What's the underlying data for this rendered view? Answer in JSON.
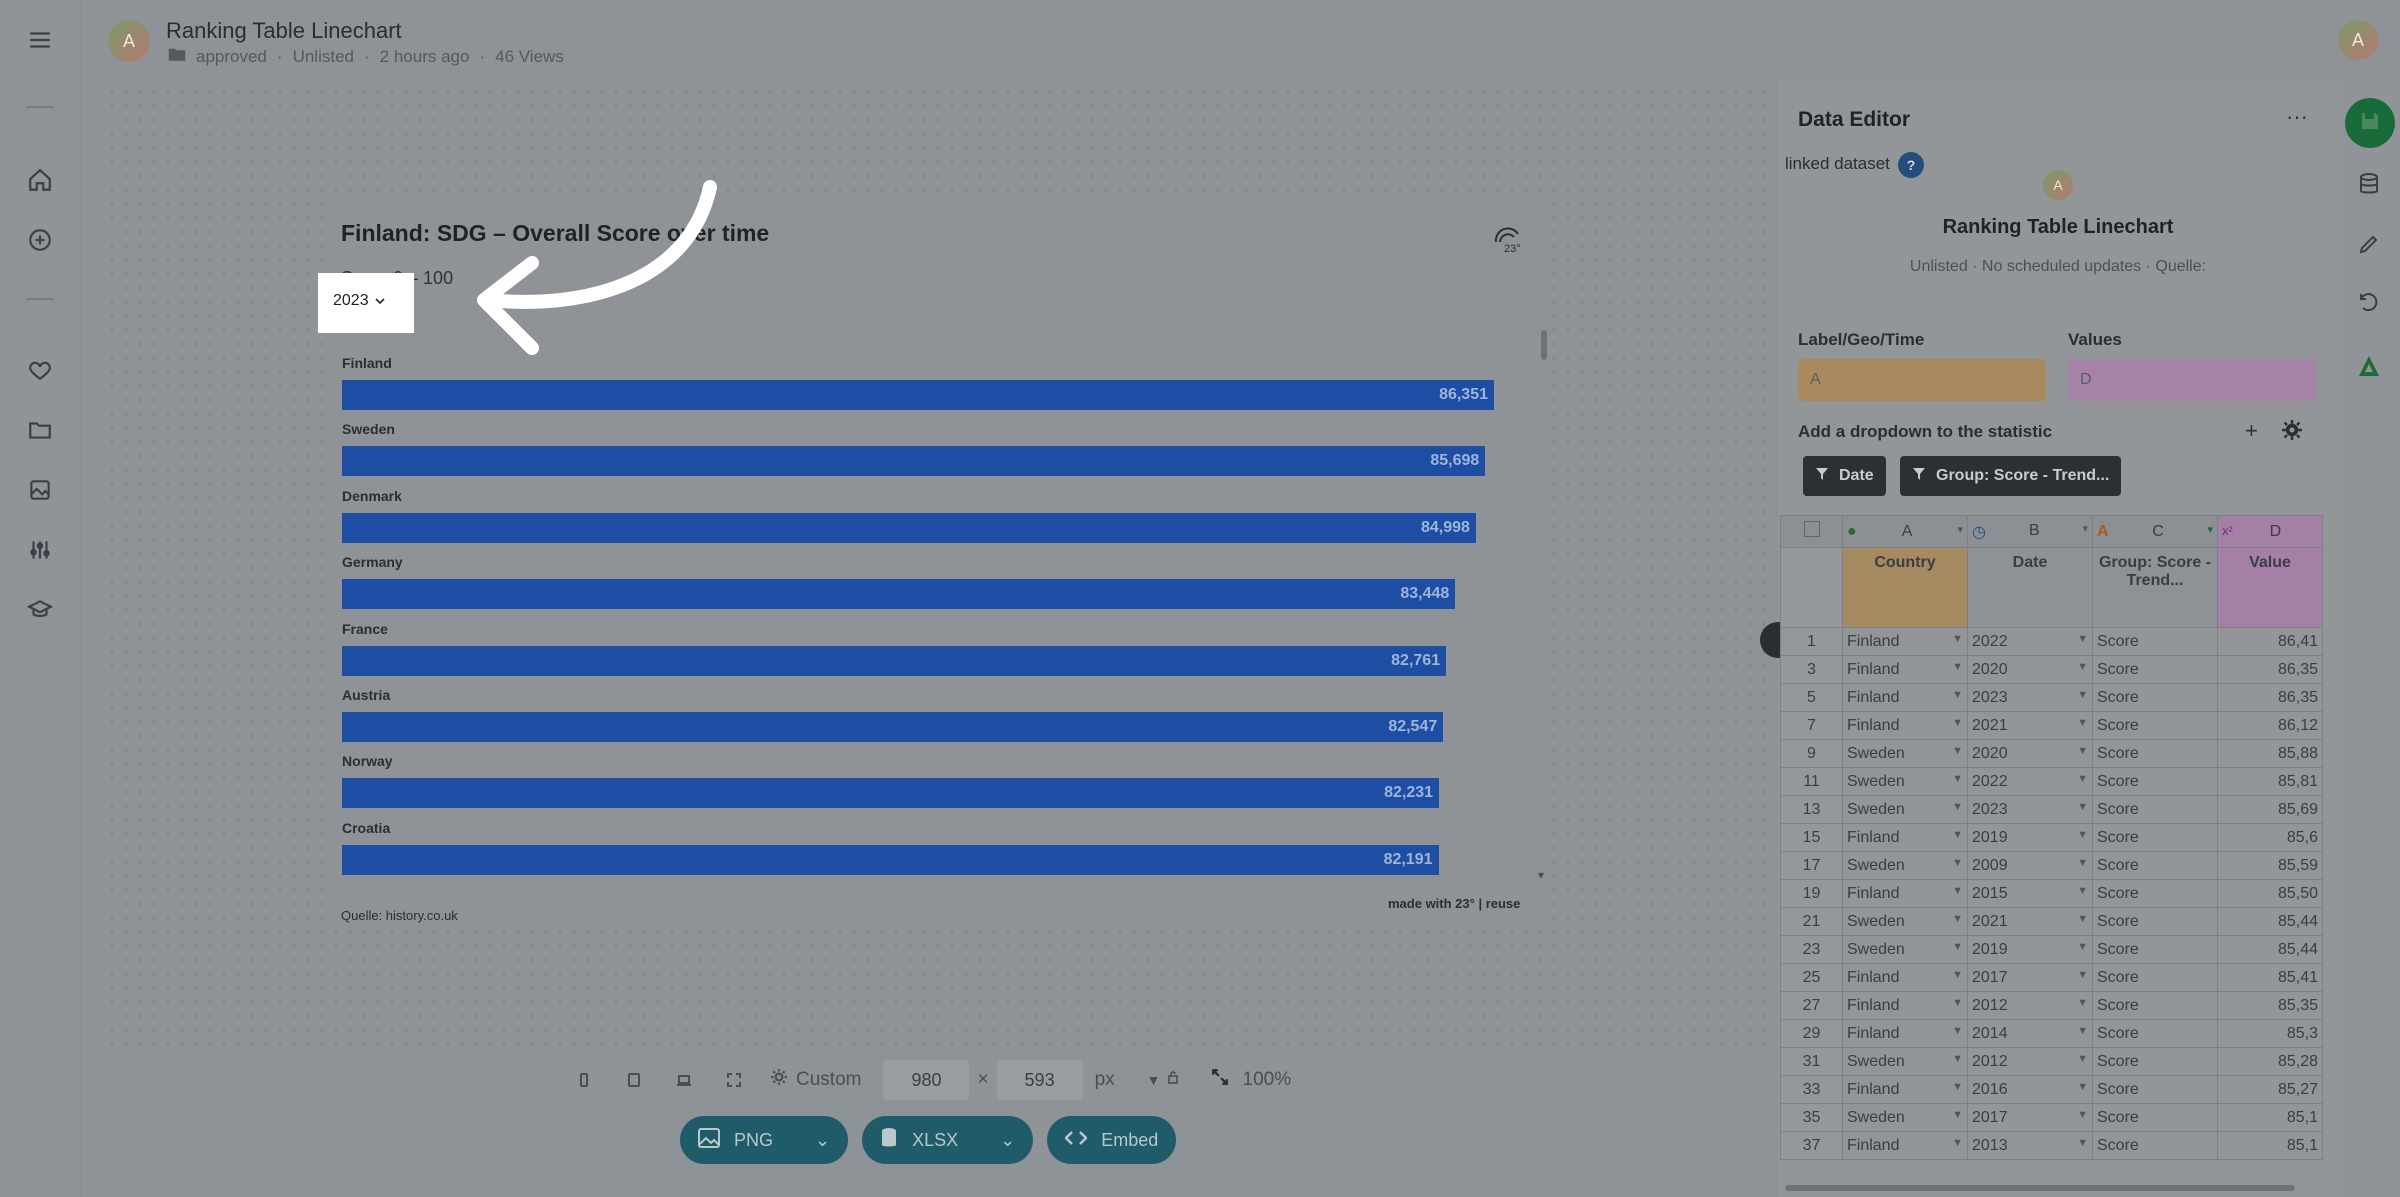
{
  "header": {
    "avatar_initial": "A",
    "title": "Ranking Table Linechart",
    "status": "approved",
    "visibility": "Unlisted",
    "time": "2 hours ago",
    "views": "46 Views",
    "user_initial": "A"
  },
  "rail": {
    "icons": [
      "menu-icon",
      "home-icon",
      "add-icon",
      "heart-icon",
      "folder-icon",
      "image-icon",
      "sliders-icon",
      "graduation-icon"
    ]
  },
  "chart": {
    "logo_text": "23°",
    "source": "Quelle: history.co.uk",
    "made_with": "made with 23° | reuse",
    "dropdown_value": "2023"
  },
  "chart_data": {
    "type": "bar",
    "title": "Finland: SDG – Overall Score over time",
    "subtitle": "Score 0 – 100",
    "categories": [
      "Finland",
      "Sweden",
      "Denmark",
      "Germany",
      "France",
      "Austria",
      "Norway",
      "Croatia"
    ],
    "values": [
      86.351,
      85.698,
      84.998,
      83.448,
      82.761,
      82.547,
      82.231,
      82.191
    ],
    "value_labels": [
      "86,351",
      "85,698",
      "84,998",
      "83,448",
      "82,761",
      "82,547",
      "82,231",
      "82,191"
    ],
    "xlim": [
      0,
      86.351
    ],
    "color": "#1e4ea3"
  },
  "toolbar": {
    "preset": "Custom",
    "width": "980",
    "times": "×",
    "height": "593",
    "unit": "px",
    "zoom": "100%"
  },
  "export": {
    "png": "PNG",
    "xlsx": "XLSX",
    "embed": "Embed"
  },
  "panel": {
    "title": "Data Editor",
    "more": "···",
    "linked": "linked dataset",
    "help": "?",
    "ds_avatar": "A",
    "ds_title": "Ranking Table Linechart",
    "ds_sub": "Unlisted · No scheduled updates · Quelle:",
    "label_geo_time": "Label/Geo/Time",
    "values_label": "Values",
    "label_col": "A",
    "values_col": "D",
    "add_dropdown": "Add a dropdown to the statistic",
    "add_plus": "+",
    "filter_date": "Date",
    "filter_group": "Group: Score - Trend...",
    "colors": {
      "label_box": "#a98a5e",
      "values_box": "#a582a8",
      "colA_header": "#a68a62",
      "colD_header": "#a47fa6"
    }
  },
  "grid": {
    "col_letters": [
      "A",
      "B",
      "C",
      "D"
    ],
    "col_names": [
      "Country",
      "Date",
      "Group: Score - Trend...",
      "Value"
    ],
    "rows": [
      {
        "n": "1",
        "country": "Finland",
        "date": "2022",
        "group": "Score",
        "value": "86,41"
      },
      {
        "n": "3",
        "country": "Finland",
        "date": "2020",
        "group": "Score",
        "value": "86,35"
      },
      {
        "n": "5",
        "country": "Finland",
        "date": "2023",
        "group": "Score",
        "value": "86,35"
      },
      {
        "n": "7",
        "country": "Finland",
        "date": "2021",
        "group": "Score",
        "value": "86,12"
      },
      {
        "n": "9",
        "country": "Sweden",
        "date": "2020",
        "group": "Score",
        "value": "85,88"
      },
      {
        "n": "11",
        "country": "Sweden",
        "date": "2022",
        "group": "Score",
        "value": "85,81"
      },
      {
        "n": "13",
        "country": "Sweden",
        "date": "2023",
        "group": "Score",
        "value": "85,69"
      },
      {
        "n": "15",
        "country": "Finland",
        "date": "2019",
        "group": "Score",
        "value": "85,6"
      },
      {
        "n": "17",
        "country": "Sweden",
        "date": "2009",
        "group": "Score",
        "value": "85,59"
      },
      {
        "n": "19",
        "country": "Finland",
        "date": "2015",
        "group": "Score",
        "value": "85,50"
      },
      {
        "n": "21",
        "country": "Sweden",
        "date": "2021",
        "group": "Score",
        "value": "85,44"
      },
      {
        "n": "23",
        "country": "Sweden",
        "date": "2019",
        "group": "Score",
        "value": "85,44"
      },
      {
        "n": "25",
        "country": "Finland",
        "date": "2017",
        "group": "Score",
        "value": "85,41"
      },
      {
        "n": "27",
        "country": "Finland",
        "date": "2012",
        "group": "Score",
        "value": "85,35"
      },
      {
        "n": "29",
        "country": "Finland",
        "date": "2014",
        "group": "Score",
        "value": "85,3"
      },
      {
        "n": "31",
        "country": "Sweden",
        "date": "2012",
        "group": "Score",
        "value": "85,28"
      },
      {
        "n": "33",
        "country": "Finland",
        "date": "2016",
        "group": "Score",
        "value": "85,27"
      },
      {
        "n": "35",
        "country": "Sweden",
        "date": "2017",
        "group": "Score",
        "value": "85,1"
      },
      {
        "n": "37",
        "country": "Finland",
        "date": "2013",
        "group": "Score",
        "value": "85,1"
      }
    ]
  }
}
